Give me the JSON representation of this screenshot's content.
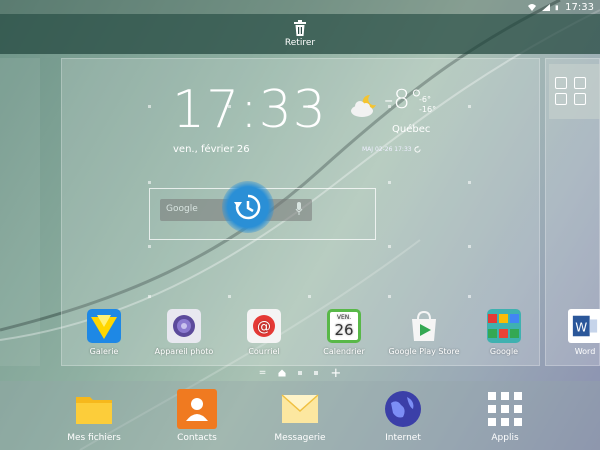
{
  "status_bar": {
    "time": "17:33"
  },
  "remove_bar": {
    "label": "Retirer"
  },
  "clock_widget": {
    "time": "17:33",
    "date": "ven., février 26",
    "temperature": "-8°",
    "high": "-6°",
    "low": "-16°",
    "city": "Québec",
    "updated": "MAJ 02-26 17:33"
  },
  "search_widget": {
    "logo_text": "Google"
  },
  "apps": [
    {
      "label": "Galerie",
      "icon": "gallery-icon"
    },
    {
      "label": "Appareil photo",
      "icon": "camera-icon"
    },
    {
      "label": "Courriel",
      "icon": "email-icon"
    },
    {
      "label": "Calendrier",
      "icon": "calendar-icon",
      "cal_month": "VEN.",
      "cal_day": "26"
    },
    {
      "label": "Google Play Store",
      "icon": "play-store-icon"
    },
    {
      "label": "Google",
      "icon": "google-folder-icon"
    }
  ],
  "right_page": {
    "app_label": "Word",
    "icon_letter": "W"
  },
  "pager": {
    "plus": "+",
    "menu": "="
  },
  "dock": [
    {
      "label": "Mes fichiers",
      "icon": "folder-icon"
    },
    {
      "label": "Contacts",
      "icon": "contacts-icon"
    },
    {
      "label": "Messagerie",
      "icon": "messages-icon"
    },
    {
      "label": "Internet",
      "icon": "internet-icon"
    },
    {
      "label": "Applis",
      "icon": "apps-grid-icon"
    }
  ],
  "colors": {
    "accent_blue": "#2a8fd6",
    "contacts_orange": "#f07a20",
    "folder_yellow": "#f6b81c",
    "calendar_green": "#58b848"
  }
}
